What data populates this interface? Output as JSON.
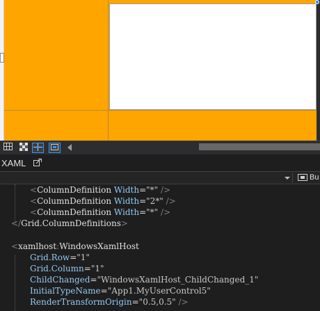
{
  "window": {
    "accent_color": "#ffa500",
    "editor_background": "#1e1e1e"
  },
  "designer": {
    "background_color": "#ffa500",
    "host_cell_color": "#ffffff",
    "grid_line_color": "#b88a3a"
  },
  "designer_toolbar": {
    "buttons": [
      {
        "icon": "grid-icon"
      },
      {
        "icon": "checkerboard-icon"
      },
      {
        "icon": "snap-icon",
        "selected": true
      },
      {
        "icon": "fit-to-screen-icon",
        "selected": true
      }
    ],
    "scroll_left_icon": "chevron-left-icon"
  },
  "tab_row": {
    "label": "XAML",
    "popout_icon": "popout-icon"
  },
  "element_selector": {
    "value": "",
    "right_label": "Bu"
  },
  "code": {
    "lines": [
      {
        "indent": "    ",
        "parts": [
          {
            "c": "t-punct",
            "t": "<"
          },
          {
            "c": "t-tag",
            "t": "ColumnDefinition"
          },
          {
            "c": "t-tag",
            "t": " "
          },
          {
            "c": "t-attr",
            "t": "Width"
          },
          {
            "c": "t-eq",
            "t": "="
          },
          {
            "c": "t-val",
            "t": "\"*\""
          },
          {
            "c": "t-tag",
            "t": " "
          },
          {
            "c": "t-punct",
            "t": "/>"
          }
        ]
      },
      {
        "indent": "    ",
        "parts": [
          {
            "c": "t-punct",
            "t": "<"
          },
          {
            "c": "t-tag",
            "t": "ColumnDefinition"
          },
          {
            "c": "t-tag",
            "t": " "
          },
          {
            "c": "t-attr",
            "t": "Width"
          },
          {
            "c": "t-eq",
            "t": "="
          },
          {
            "c": "t-val",
            "t": "\"2*\""
          },
          {
            "c": "t-tag",
            "t": " "
          },
          {
            "c": "t-punct",
            "t": "/>"
          }
        ]
      },
      {
        "indent": "    ",
        "parts": [
          {
            "c": "t-punct",
            "t": "<"
          },
          {
            "c": "t-tag",
            "t": "ColumnDefinition"
          },
          {
            "c": "t-tag",
            "t": " "
          },
          {
            "c": "t-attr",
            "t": "Width"
          },
          {
            "c": "t-eq",
            "t": "="
          },
          {
            "c": "t-val",
            "t": "\"*\""
          },
          {
            "c": "t-tag",
            "t": " "
          },
          {
            "c": "t-punct",
            "t": "/>"
          }
        ]
      },
      {
        "indent": "  ",
        "parts": [
          {
            "c": "t-punct",
            "t": "</"
          },
          {
            "c": "t-tag",
            "t": "Grid.ColumnDefinitions"
          },
          {
            "c": "t-punct",
            "t": ">"
          }
        ]
      },
      {
        "indent": "",
        "parts": []
      },
      {
        "indent": "  ",
        "parts": [
          {
            "c": "t-punct",
            "t": "<"
          },
          {
            "c": "t-tag",
            "t": "xamlhost"
          },
          {
            "c": "t-punct",
            "t": ":"
          },
          {
            "c": "t-tag",
            "t": "WindowsXamlHost"
          }
        ]
      },
      {
        "indent": "    ",
        "parts": [
          {
            "c": "t-attr",
            "t": "Grid.Row"
          },
          {
            "c": "t-eq",
            "t": "="
          },
          {
            "c": "t-val",
            "t": "\"1\""
          }
        ]
      },
      {
        "indent": "    ",
        "parts": [
          {
            "c": "t-attr",
            "t": "Grid.Column"
          },
          {
            "c": "t-eq",
            "t": "="
          },
          {
            "c": "t-val",
            "t": "\"1\""
          }
        ]
      },
      {
        "indent": "    ",
        "parts": [
          {
            "c": "t-attr",
            "t": "ChildChanged"
          },
          {
            "c": "t-eq",
            "t": "="
          },
          {
            "c": "t-val",
            "t": "\"WindowsXamlHost_ChildChanged_1\""
          }
        ]
      },
      {
        "indent": "    ",
        "parts": [
          {
            "c": "t-attr",
            "t": "InitialTypeName"
          },
          {
            "c": "t-eq",
            "t": "="
          },
          {
            "c": "t-val",
            "t": "\"App1.MyUserControl5\""
          }
        ]
      },
      {
        "indent": "    ",
        "parts": [
          {
            "c": "t-attr",
            "t": "RenderTransformOrigin"
          },
          {
            "c": "t-eq",
            "t": "="
          },
          {
            "c": "t-val",
            "t": "\"0.5,0.5\""
          },
          {
            "c": "t-tag",
            "t": " "
          },
          {
            "c": "t-punct",
            "t": "/>"
          }
        ]
      }
    ]
  }
}
